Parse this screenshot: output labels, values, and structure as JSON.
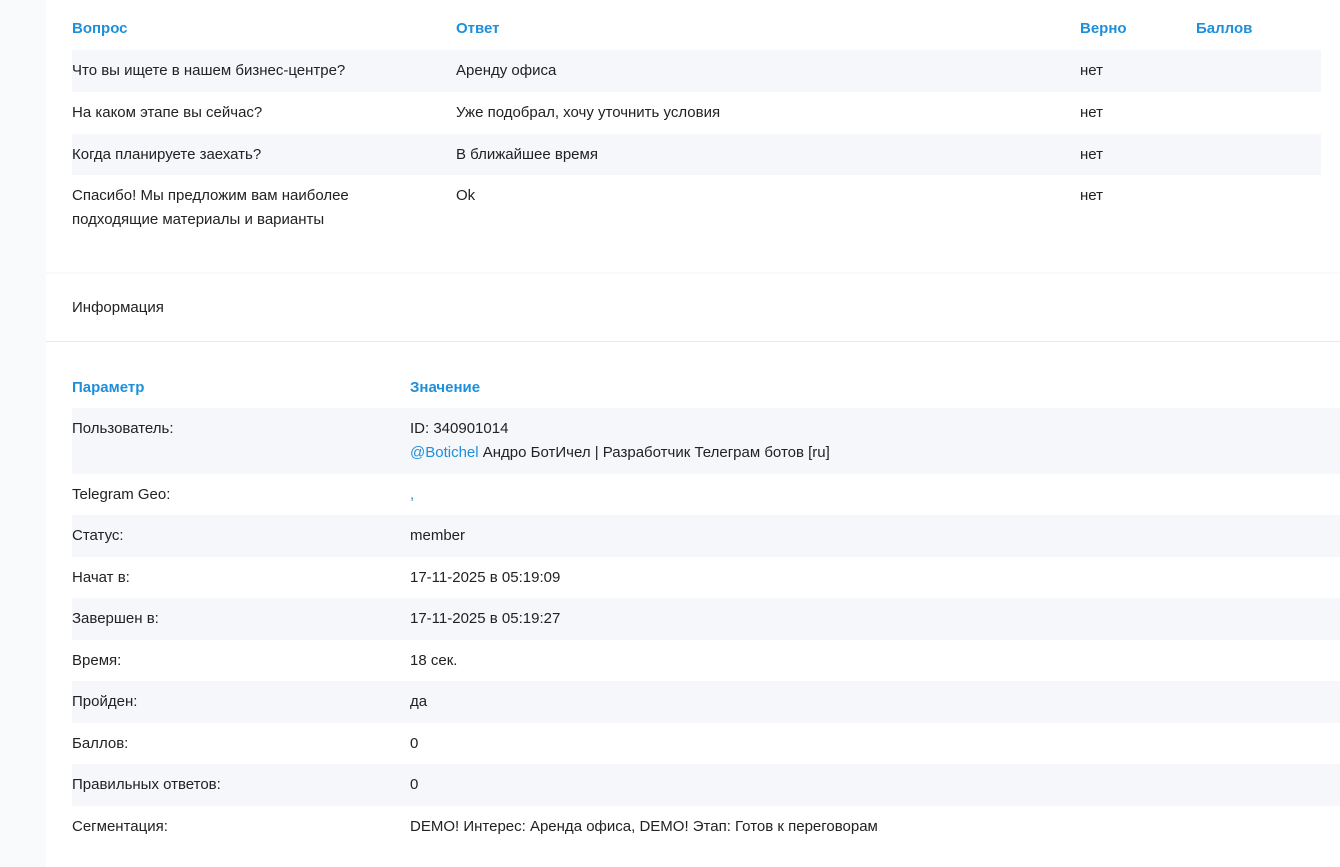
{
  "answers": {
    "headers": {
      "question": "Вопрос",
      "answer": "Ответ",
      "correct": "Верно",
      "points": "Баллов"
    },
    "rows": [
      {
        "question": "Что вы ищете в нашем бизнес-центре?",
        "answer": "Аренду офиса",
        "correct": "нет",
        "points": ""
      },
      {
        "question": "На каком этапе вы сейчас?",
        "answer": "Уже подобрал, хочу уточнить условия",
        "correct": "нет",
        "points": ""
      },
      {
        "question": "Когда планируете заехать?",
        "answer": "В ближайшее время",
        "correct": "нет",
        "points": ""
      },
      {
        "question_line1": "Спасибо! Мы предложим вам наиболее",
        "question_line2": "подходящие материалы и варианты",
        "answer": "Ok",
        "correct": "нет",
        "points": ""
      }
    ]
  },
  "info": {
    "title": "Информация",
    "headers": {
      "param": "Параметр",
      "value": "Значение"
    },
    "user": {
      "label": "Пользователь:",
      "id_line": "ID: 340901014",
      "handle": "@Botichel",
      "name": " Андро БотИчел | Разработчик Телеграм ботов [ru]"
    },
    "geo": {
      "label": "Telegram Geo:",
      "value": ","
    },
    "status": {
      "label": "Статус:",
      "value": "member"
    },
    "started": {
      "label": "Начат в:",
      "value": "17-11-2025 в 05:19:09"
    },
    "finished": {
      "label": "Завершен в:",
      "value": "17-11-2025 в 05:19:27"
    },
    "time": {
      "label": "Время:",
      "value": "18 сек."
    },
    "passed": {
      "label": "Пройден:",
      "value": "да"
    },
    "points": {
      "label": "Баллов:",
      "value": "0"
    },
    "correct_answers": {
      "label": "Правильных ответов:",
      "value": "0"
    },
    "segmentation": {
      "label": "Сегментация:",
      "value": "DEMO! Интерес: Аренда офиса, DEMO! Этап: Готов к переговорам"
    }
  },
  "colors": {
    "accent": "#1e8fdb",
    "stripe": "#f5f7fa",
    "page_bg": "#f9fafc"
  }
}
